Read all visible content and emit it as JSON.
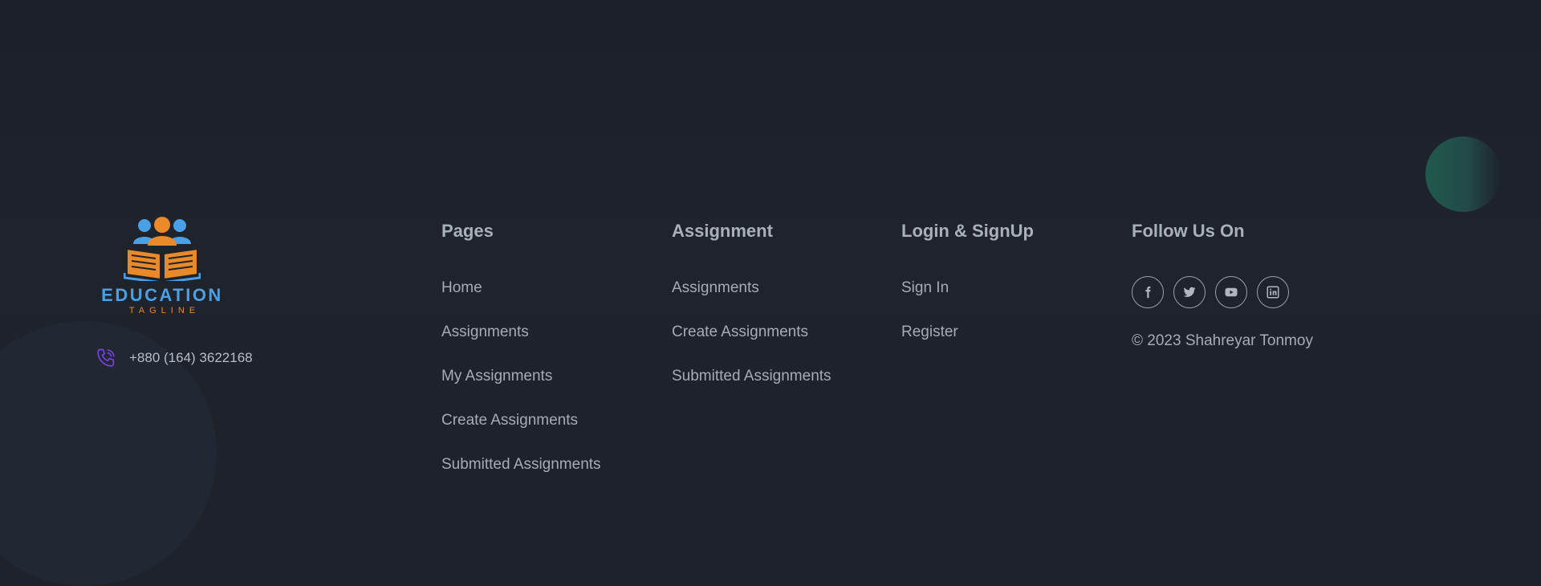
{
  "brand": {
    "name": "EDUCATION",
    "tagline": "TAGLINE",
    "colors": {
      "name": "#4aa0e6",
      "tagline": "#e8892a"
    }
  },
  "contact": {
    "icon": "phone-icon",
    "phone": "+880 (164) 3622168"
  },
  "columns": {
    "pages": {
      "heading": "Pages",
      "links": [
        "Home",
        "Assignments",
        "My Assignments",
        "Create Assignments",
        "Submitted Assignments"
      ]
    },
    "assignment": {
      "heading": "Assignment",
      "links": [
        "Assignments",
        "Create Assignments",
        "Submitted Assignments"
      ]
    },
    "auth": {
      "heading": "Login & SignUp",
      "links": [
        "Sign In",
        "Register"
      ]
    }
  },
  "social": {
    "heading": "Follow Us On",
    "icons": [
      "facebook-icon",
      "twitter-icon",
      "youtube-icon",
      "linkedin-icon"
    ],
    "copyright": "© 2023 Shahreyar Tonmoy"
  }
}
